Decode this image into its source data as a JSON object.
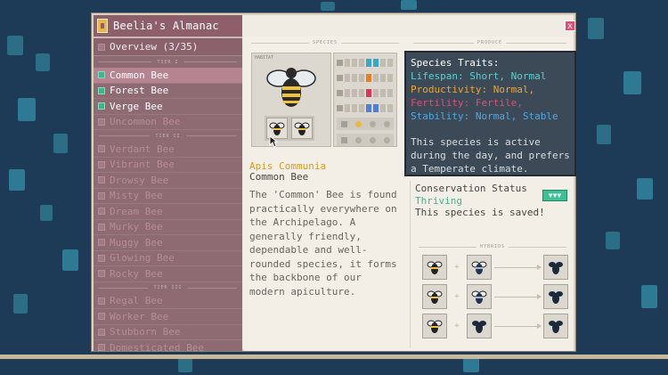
{
  "window": {
    "title": "Beelia's Almanac",
    "close_label": "x"
  },
  "sidebar": {
    "overview": "Overview (3/35)",
    "tiers": [
      "TIER I",
      "TIER II",
      "TIER III"
    ],
    "tier1": [
      {
        "label": "Common Bee",
        "known": true,
        "selected": true
      },
      {
        "label": "Forest Bee",
        "known": true
      },
      {
        "label": "Verge Bee",
        "known": true
      },
      {
        "label": "Uncommon Bee",
        "known": false
      }
    ],
    "tier2": [
      {
        "label": "Verdant Bee"
      },
      {
        "label": "Vibrant Bee"
      },
      {
        "label": "Drowsy Bee"
      },
      {
        "label": "Misty Bee"
      },
      {
        "label": "Dream Bee"
      },
      {
        "label": "Murky Bee"
      },
      {
        "label": "Muggy Bee"
      },
      {
        "label": "Glowing Bee"
      },
      {
        "label": "Rocky Bee"
      }
    ],
    "tier3": [
      {
        "label": "Regal Bee"
      },
      {
        "label": "Worker Bee"
      },
      {
        "label": "Stubborn Bee"
      },
      {
        "label": "Domesticated Bee"
      }
    ]
  },
  "sections": {
    "species": "SPECIES",
    "produce": "PRODUCE",
    "hybrids": "HYBRIDS",
    "box_label": "HABITAT"
  },
  "tooltip": {
    "title": "Species Traits:",
    "lifespan": "Lifespan: Short, Normal",
    "productivity": "Productivity: Normal,",
    "fertility": "Fertility: Fertile,",
    "stability": "Stability: Normal, Stable",
    "desc": "This species is active during the day, and prefers a Temperate climate.",
    "colors": {
      "lifespan": "#4fd6d6",
      "productivity": "#f2a531",
      "fertility": "#e84a73",
      "stability": "#4fa8e8"
    }
  },
  "species": {
    "scientific": "Apis Communia",
    "common": "Common Bee",
    "description": "The 'Common' Bee is found practically everywhere on the Archipelago. A generally friendly, dependable and well-rounded species, it forms the backbone of our modern apiculture.",
    "stat_letters": [
      "S",
      "N",
      "F",
      "S"
    ]
  },
  "conservation": {
    "label": "Conservation Status",
    "value": "Thriving",
    "desc": "This species is saved!",
    "badge": "▼▼▼"
  }
}
